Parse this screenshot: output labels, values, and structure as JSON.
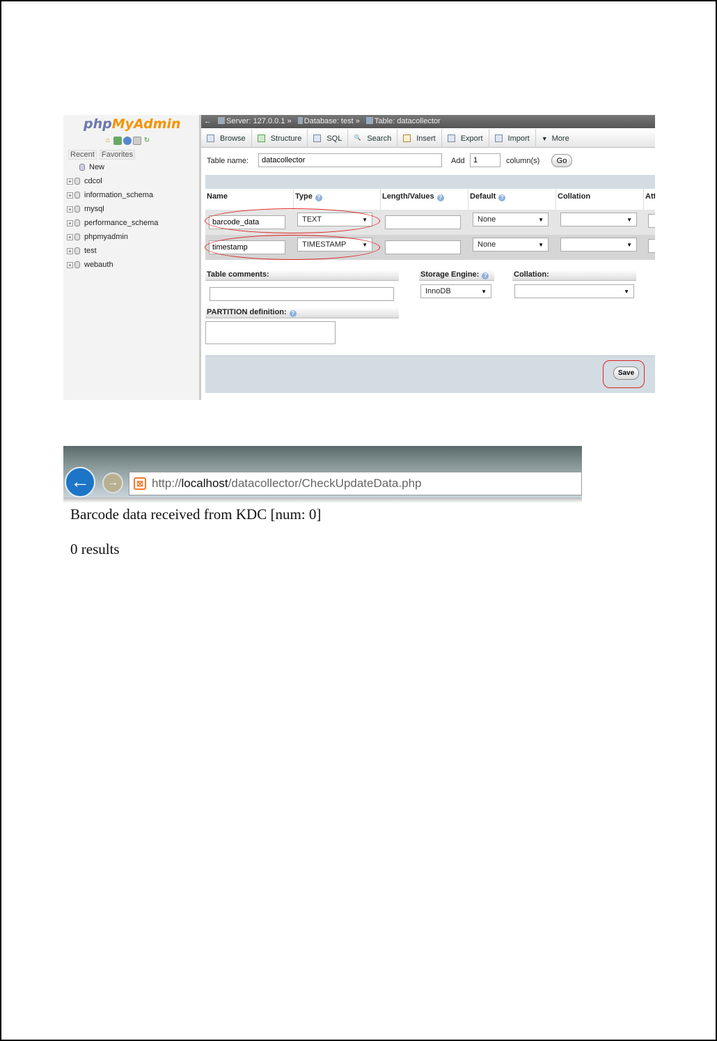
{
  "pma": {
    "logo_php": "php",
    "logo_myadmin": "MyAdmin",
    "nav_tabs": [
      "Recent",
      "Favorites"
    ],
    "tree": {
      "new_label": "New",
      "databases": [
        "cdcol",
        "information_schema",
        "mysql",
        "performance_schema",
        "phpmyadmin",
        "test",
        "webauth"
      ]
    },
    "breadcrumb": {
      "back_arrow": "←",
      "server": "Server: 127.0.0.1",
      "database": "Database: test",
      "table": "Table: datacollector",
      "separator": "»"
    },
    "toolbar": [
      "Browse",
      "Structure",
      "SQL",
      "Search",
      "Insert",
      "Export",
      "Import",
      "More"
    ],
    "table_name_label": "Table name:",
    "table_name_value": "datacollector",
    "add_label": "Add",
    "add_value": "1",
    "columns_label": "column(s)",
    "go_label": "Go",
    "headers": [
      "Name",
      "Type",
      "Length/Values",
      "Default",
      "Collation",
      "Att"
    ],
    "rows": [
      {
        "name": "barcode_data",
        "type": "TEXT",
        "default": "None",
        "collation": ""
      },
      {
        "name": "timestamp",
        "type": "TIMESTAMP",
        "default": "None",
        "collation": ""
      }
    ],
    "table_comments_label": "Table comments:",
    "storage_engine_label": "Storage Engine:",
    "storage_engine_value": "InnoDB",
    "collation_label": "Collation:",
    "partition_label": "PARTITION definition:",
    "save_label": "Save",
    "colors": {
      "accent_highlight": "#d22222",
      "band": "#d3dce3"
    }
  },
  "browser": {
    "url_prefix": "http://",
    "url_host": "localhost",
    "url_path": "/datacollector/CheckUpdateData.php",
    "heading": "Barcode data received from KDC [num: 0]",
    "results": "0 results"
  }
}
